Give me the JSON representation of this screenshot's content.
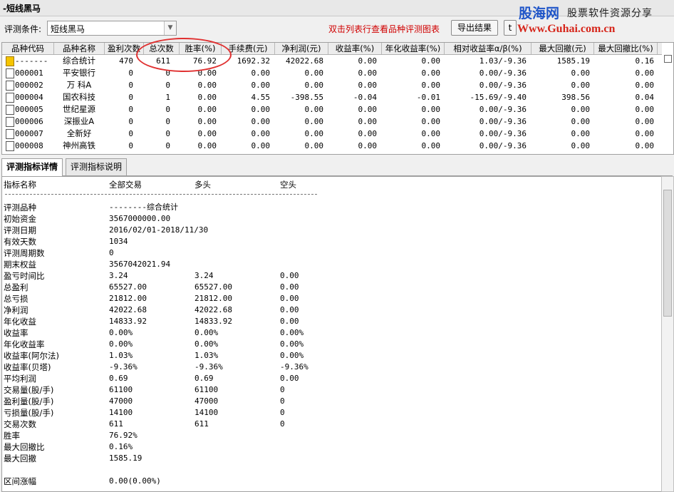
{
  "window": {
    "title": "-短线黑马"
  },
  "watermark": {
    "brand": "股海网",
    "slogan": "股票软件资源分享",
    "url": "Www.Guhai.com.cn"
  },
  "toolbar": {
    "cond_label": "评测条件:",
    "cond_value": "短线黑马",
    "hint": "双击列表行查看品种评测图表",
    "export_label": "导出结果",
    "next_label": "t"
  },
  "table": {
    "columns": [
      "品种代码",
      "品种名称",
      "盈利次数",
      "总次数",
      "胜率(%)",
      "手续费(元)",
      "净利润(元)",
      "收益率(%)",
      "年化收益率(%)",
      "相对收益率α/β(%)",
      "最大回撤(元)",
      "最大回撤比(%)"
    ],
    "rows": [
      {
        "code": "-------",
        "name": "综合统计",
        "win": "470",
        "total": "611",
        "rate": "76.92",
        "fee": "1692.32",
        "profit": "42022.68",
        "ret": "0.00",
        "annual": "0.00",
        "ab": "1.03/-9.36",
        "dd": "1585.19",
        "ddr": "0.16"
      },
      {
        "code": "000001",
        "name": "平安银行",
        "win": "0",
        "total": "0",
        "rate": "0.00",
        "fee": "0.00",
        "profit": "0.00",
        "ret": "0.00",
        "annual": "0.00",
        "ab": "0.00/-9.36",
        "dd": "0.00",
        "ddr": "0.00"
      },
      {
        "code": "000002",
        "name": "万 科A",
        "win": "0",
        "total": "0",
        "rate": "0.00",
        "fee": "0.00",
        "profit": "0.00",
        "ret": "0.00",
        "annual": "0.00",
        "ab": "0.00/-9.36",
        "dd": "0.00",
        "ddr": "0.00"
      },
      {
        "code": "000004",
        "name": "国农科技",
        "win": "0",
        "total": "1",
        "rate": "0.00",
        "fee": "4.55",
        "profit": "-398.55",
        "ret": "-0.04",
        "annual": "-0.01",
        "ab": "-15.69/-9.40",
        "dd": "398.56",
        "ddr": "0.04"
      },
      {
        "code": "000005",
        "name": "世纪星源",
        "win": "0",
        "total": "0",
        "rate": "0.00",
        "fee": "0.00",
        "profit": "0.00",
        "ret": "0.00",
        "annual": "0.00",
        "ab": "0.00/-9.36",
        "dd": "0.00",
        "ddr": "0.00"
      },
      {
        "code": "000006",
        "name": "深振业A",
        "win": "0",
        "total": "0",
        "rate": "0.00",
        "fee": "0.00",
        "profit": "0.00",
        "ret": "0.00",
        "annual": "0.00",
        "ab": "0.00/-9.36",
        "dd": "0.00",
        "ddr": "0.00"
      },
      {
        "code": "000007",
        "name": "全新好",
        "win": "0",
        "total": "0",
        "rate": "0.00",
        "fee": "0.00",
        "profit": "0.00",
        "ret": "0.00",
        "annual": "0.00",
        "ab": "0.00/-9.36",
        "dd": "0.00",
        "ddr": "0.00"
      },
      {
        "code": "000008",
        "name": "神州高铁",
        "win": "0",
        "total": "0",
        "rate": "0.00",
        "fee": "0.00",
        "profit": "0.00",
        "ret": "0.00",
        "annual": "0.00",
        "ab": "0.00/-9.36",
        "dd": "0.00",
        "ddr": "0.00"
      }
    ]
  },
  "tabs": [
    "评测指标详情",
    "评测指标说明"
  ],
  "detail": {
    "headers": [
      "指标名称",
      "全部交易",
      "多头",
      "空头"
    ],
    "rows": [
      {
        "label": "评测品种",
        "all": "--------综合统计",
        "long": "",
        "short": ""
      },
      {
        "label": "初始资金",
        "all": "3567000000.00",
        "long": "",
        "short": ""
      },
      {
        "label": "评测日期",
        "all": "2016/02/01-2018/11/30",
        "long": "",
        "short": ""
      },
      {
        "label": "有效天数",
        "all": "1034",
        "long": "",
        "short": ""
      },
      {
        "label": "评测周期数",
        "all": "0",
        "long": "",
        "short": ""
      },
      {
        "label": "期末权益",
        "all": "3567042021.94",
        "long": "",
        "short": ""
      },
      {
        "label": "盈亏时间比",
        "all": "3.24",
        "long": "3.24",
        "short": "0.00"
      },
      {
        "label": "总盈利",
        "all": "65527.00",
        "long": "65527.00",
        "short": "0.00"
      },
      {
        "label": "总亏损",
        "all": "21812.00",
        "long": "21812.00",
        "short": "0.00"
      },
      {
        "label": "净利润",
        "all": "42022.68",
        "long": "42022.68",
        "short": "0.00"
      },
      {
        "label": "年化收益",
        "all": "14833.92",
        "long": "14833.92",
        "short": "0.00"
      },
      {
        "label": "收益率",
        "all": "0.00%",
        "long": "0.00%",
        "short": "0.00%"
      },
      {
        "label": "年化收益率",
        "all": "0.00%",
        "long": "0.00%",
        "short": "0.00%"
      },
      {
        "label": "收益率(阿尔法)",
        "all": "1.03%",
        "long": "1.03%",
        "short": "0.00%"
      },
      {
        "label": "收益率(贝塔)",
        "all": "-9.36%",
        "long": "-9.36%",
        "short": "-9.36%"
      },
      {
        "label": "平均利润",
        "all": "0.69",
        "long": "0.69",
        "short": "0.00"
      },
      {
        "label": "交易量(股/手)",
        "all": "61100",
        "long": "61100",
        "short": "0"
      },
      {
        "label": "盈利量(股/手)",
        "all": "47000",
        "long": "47000",
        "short": "0"
      },
      {
        "label": "亏损量(股/手)",
        "all": "14100",
        "long": "14100",
        "short": "0"
      },
      {
        "label": "交易次数",
        "all": "611",
        "long": "611",
        "short": "0"
      },
      {
        "label": "胜率",
        "all": "76.92%",
        "long": "",
        "short": ""
      },
      {
        "label": "最大回撤比",
        "all": "0.16%",
        "long": "",
        "short": ""
      },
      {
        "label": "最大回撤",
        "all": "1585.19",
        "long": "",
        "short": ""
      },
      {
        "label": "",
        "all": "",
        "long": "",
        "short": ""
      },
      {
        "label": "区间涨幅",
        "all": "0.00(0.00%)",
        "long": "",
        "short": ""
      }
    ]
  }
}
